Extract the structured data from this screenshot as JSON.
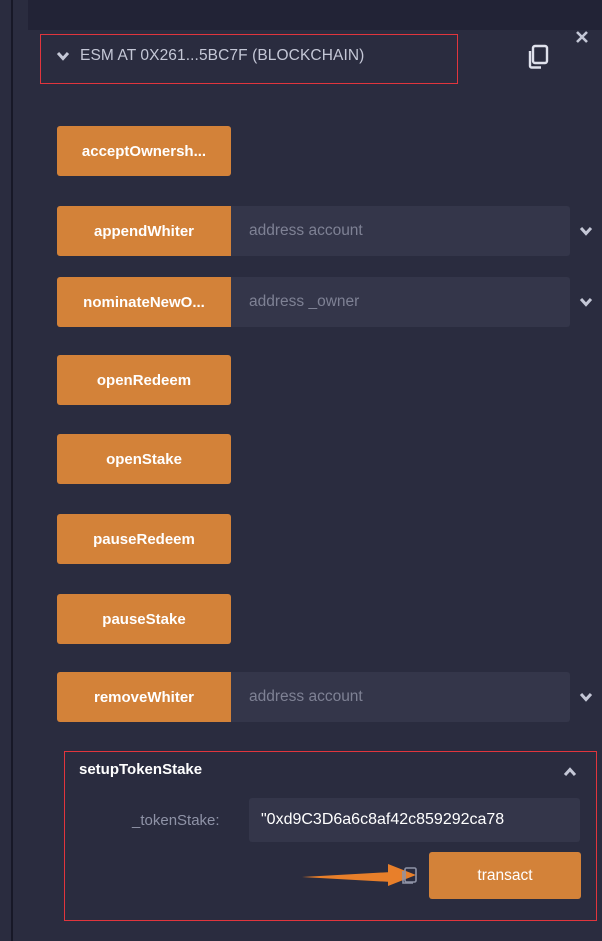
{
  "panel": {
    "title": "ESM AT 0X261...5BC7F (BLOCKCHAIN)",
    "icons": {
      "toggle": "chevron-down-icon",
      "copy": "copy-icon",
      "close": "close-icon"
    }
  },
  "functions": [
    {
      "label": "acceptOwnersh..."
    },
    {
      "label": "appendWhiter",
      "placeholder": "address account"
    },
    {
      "label": "nominateNewO...",
      "placeholder": "address _owner"
    },
    {
      "label": "openRedeem"
    },
    {
      "label": "openStake"
    },
    {
      "label": "pauseRedeem"
    },
    {
      "label": "pauseStake"
    },
    {
      "label": "removeWhiter",
      "placeholder": "address account"
    }
  ],
  "setup": {
    "title": "setupTokenStake",
    "param_label": "_tokenStake:",
    "param_value": "\"0xd9C3D6a6c8af42c859292ca78",
    "action_label": "transact"
  },
  "colors": {
    "accent": "#d38239",
    "highlight": "#e0353d",
    "background": "#2a2c3f",
    "input": "#34364a"
  }
}
